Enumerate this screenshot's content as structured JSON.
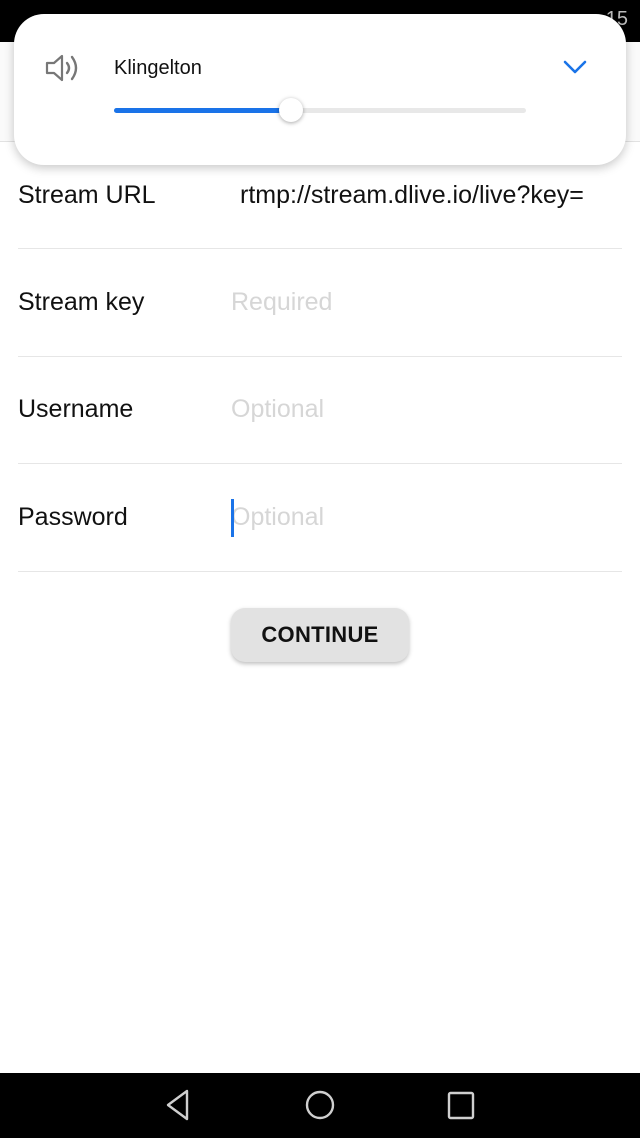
{
  "status_bar": {
    "time_fragment": "15"
  },
  "volume_panel": {
    "stream_label": "Klingelton",
    "icon": "speaker-icon",
    "expand_icon": "chevron-down-icon",
    "level_fraction": 0.43,
    "accent_color": "#1a73e8"
  },
  "form": {
    "fields": [
      {
        "label": "Stream URL",
        "value": "rtmp://stream.dlive.io/live?key=",
        "placeholder": ""
      },
      {
        "label": "Stream key",
        "value": "",
        "placeholder": "Required"
      },
      {
        "label": "Username",
        "value": "",
        "placeholder": "Optional"
      },
      {
        "label": "Password",
        "value": "",
        "placeholder": "Optional",
        "focused": true
      }
    ],
    "continue_label": "CONTINUE"
  },
  "nav_bar": {
    "back": "back-icon",
    "home": "home-icon",
    "recents": "recents-icon"
  }
}
